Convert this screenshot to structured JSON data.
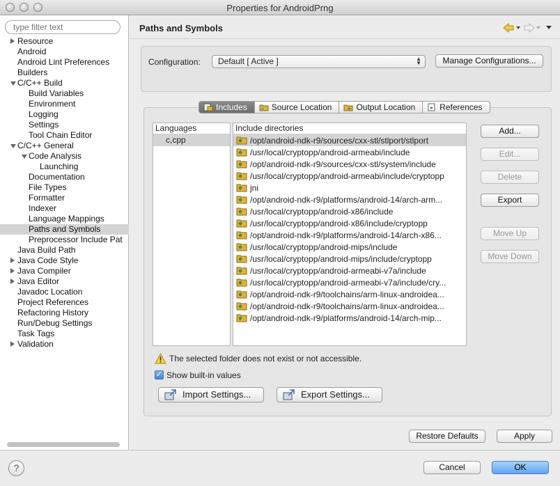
{
  "window": {
    "title": "Properties for AndroidPrng"
  },
  "sidebar": {
    "filter_placeholder": "type filter text",
    "items": [
      {
        "label": "Resource",
        "indent": 0,
        "toggle": "collapsed"
      },
      {
        "label": "Android",
        "indent": 0,
        "toggle": "none"
      },
      {
        "label": "Android Lint Preferences",
        "indent": 0,
        "toggle": "none"
      },
      {
        "label": "Builders",
        "indent": 0,
        "toggle": "none"
      },
      {
        "label": "C/C++ Build",
        "indent": 0,
        "toggle": "expanded"
      },
      {
        "label": "Build Variables",
        "indent": 1,
        "toggle": "none"
      },
      {
        "label": "Environment",
        "indent": 1,
        "toggle": "none"
      },
      {
        "label": "Logging",
        "indent": 1,
        "toggle": "none"
      },
      {
        "label": "Settings",
        "indent": 1,
        "toggle": "none"
      },
      {
        "label": "Tool Chain Editor",
        "indent": 1,
        "toggle": "none"
      },
      {
        "label": "C/C++ General",
        "indent": 0,
        "toggle": "expanded"
      },
      {
        "label": "Code Analysis",
        "indent": 1,
        "toggle": "expanded"
      },
      {
        "label": "Launching",
        "indent": 2,
        "toggle": "none"
      },
      {
        "label": "Documentation",
        "indent": 1,
        "toggle": "none"
      },
      {
        "label": "File Types",
        "indent": 1,
        "toggle": "none"
      },
      {
        "label": "Formatter",
        "indent": 1,
        "toggle": "none"
      },
      {
        "label": "Indexer",
        "indent": 1,
        "toggle": "none"
      },
      {
        "label": "Language Mappings",
        "indent": 1,
        "toggle": "none"
      },
      {
        "label": "Paths and Symbols",
        "indent": 1,
        "toggle": "none",
        "selected": true
      },
      {
        "label": "Preprocessor Include Pat",
        "indent": 1,
        "toggle": "none"
      },
      {
        "label": "Java Build Path",
        "indent": 0,
        "toggle": "none"
      },
      {
        "label": "Java Code Style",
        "indent": 0,
        "toggle": "collapsed"
      },
      {
        "label": "Java Compiler",
        "indent": 0,
        "toggle": "collapsed"
      },
      {
        "label": "Java Editor",
        "indent": 0,
        "toggle": "collapsed"
      },
      {
        "label": "Javadoc Location",
        "indent": 0,
        "toggle": "none"
      },
      {
        "label": "Project References",
        "indent": 0,
        "toggle": "none"
      },
      {
        "label": "Refactoring History",
        "indent": 0,
        "toggle": "none"
      },
      {
        "label": "Run/Debug Settings",
        "indent": 0,
        "toggle": "none"
      },
      {
        "label": "Task Tags",
        "indent": 0,
        "toggle": "none"
      },
      {
        "label": "Validation",
        "indent": 0,
        "toggle": "collapsed"
      }
    ]
  },
  "page": {
    "title": "Paths and Symbols",
    "configuration_label": "Configuration:",
    "configuration_value": "Default  [ Active ]",
    "manage_button": "Manage Configurations..."
  },
  "tabs": [
    {
      "label": "Includes",
      "active": true
    },
    {
      "label": "Source Location",
      "active": false
    },
    {
      "label": "Output Location",
      "active": false
    },
    {
      "label": "References",
      "active": false
    }
  ],
  "languages": {
    "header": "Languages",
    "items": [
      "c,cpp"
    ]
  },
  "includes": {
    "header": "Include directories",
    "items": [
      "/opt/android-ndk-r9/sources/cxx-stl/stlport/stlport",
      "/usr/local/cryptopp/android-armeabi/include",
      "/opt/android-ndk-r9/sources/cxx-stl/system/include",
      "/usr/local/cryptopp/android-armeabi/include/cryptopp",
      "jni",
      "/opt/android-ndk-r9/platforms/android-14/arch-arm...",
      "/usr/local/cryptopp/android-x86/include",
      "/usr/local/cryptopp/android-x86/include/cryptopp",
      "/opt/android-ndk-r9/platforms/android-14/arch-x86...",
      "/usr/local/cryptopp/android-mips/include",
      "/usr/local/cryptopp/android-mips/include/cryptopp",
      "/usr/local/cryptopp/android-armeabi-v7a/include",
      "/usr/local/cryptopp/android-armeabi-v7a/include/cry...",
      "/opt/android-ndk-r9/toolchains/arm-linux-androidea...",
      "/opt/android-ndk-r9/toolchains/arm-linux-androidea...",
      "/opt/android-ndk-r9/platforms/android-14/arch-mip..."
    ]
  },
  "side_buttons": {
    "add": "Add...",
    "edit": "Edit...",
    "delete": "Delete",
    "export": "Export",
    "move_up": "Move Up",
    "move_down": "Move Down"
  },
  "warning": "The selected folder does not exist or not accessible.",
  "show_builtin": {
    "label": "Show built-in values",
    "checked": true
  },
  "import_settings": "Import Settings...",
  "export_settings": "Export Settings...",
  "restore_defaults": "Restore Defaults",
  "apply": "Apply",
  "cancel": "Cancel",
  "ok": "OK",
  "help": "?",
  "colors": {
    "accent": "#5fa6ef",
    "selection": "#d4d4d4",
    "folder": "#e3b23c"
  }
}
